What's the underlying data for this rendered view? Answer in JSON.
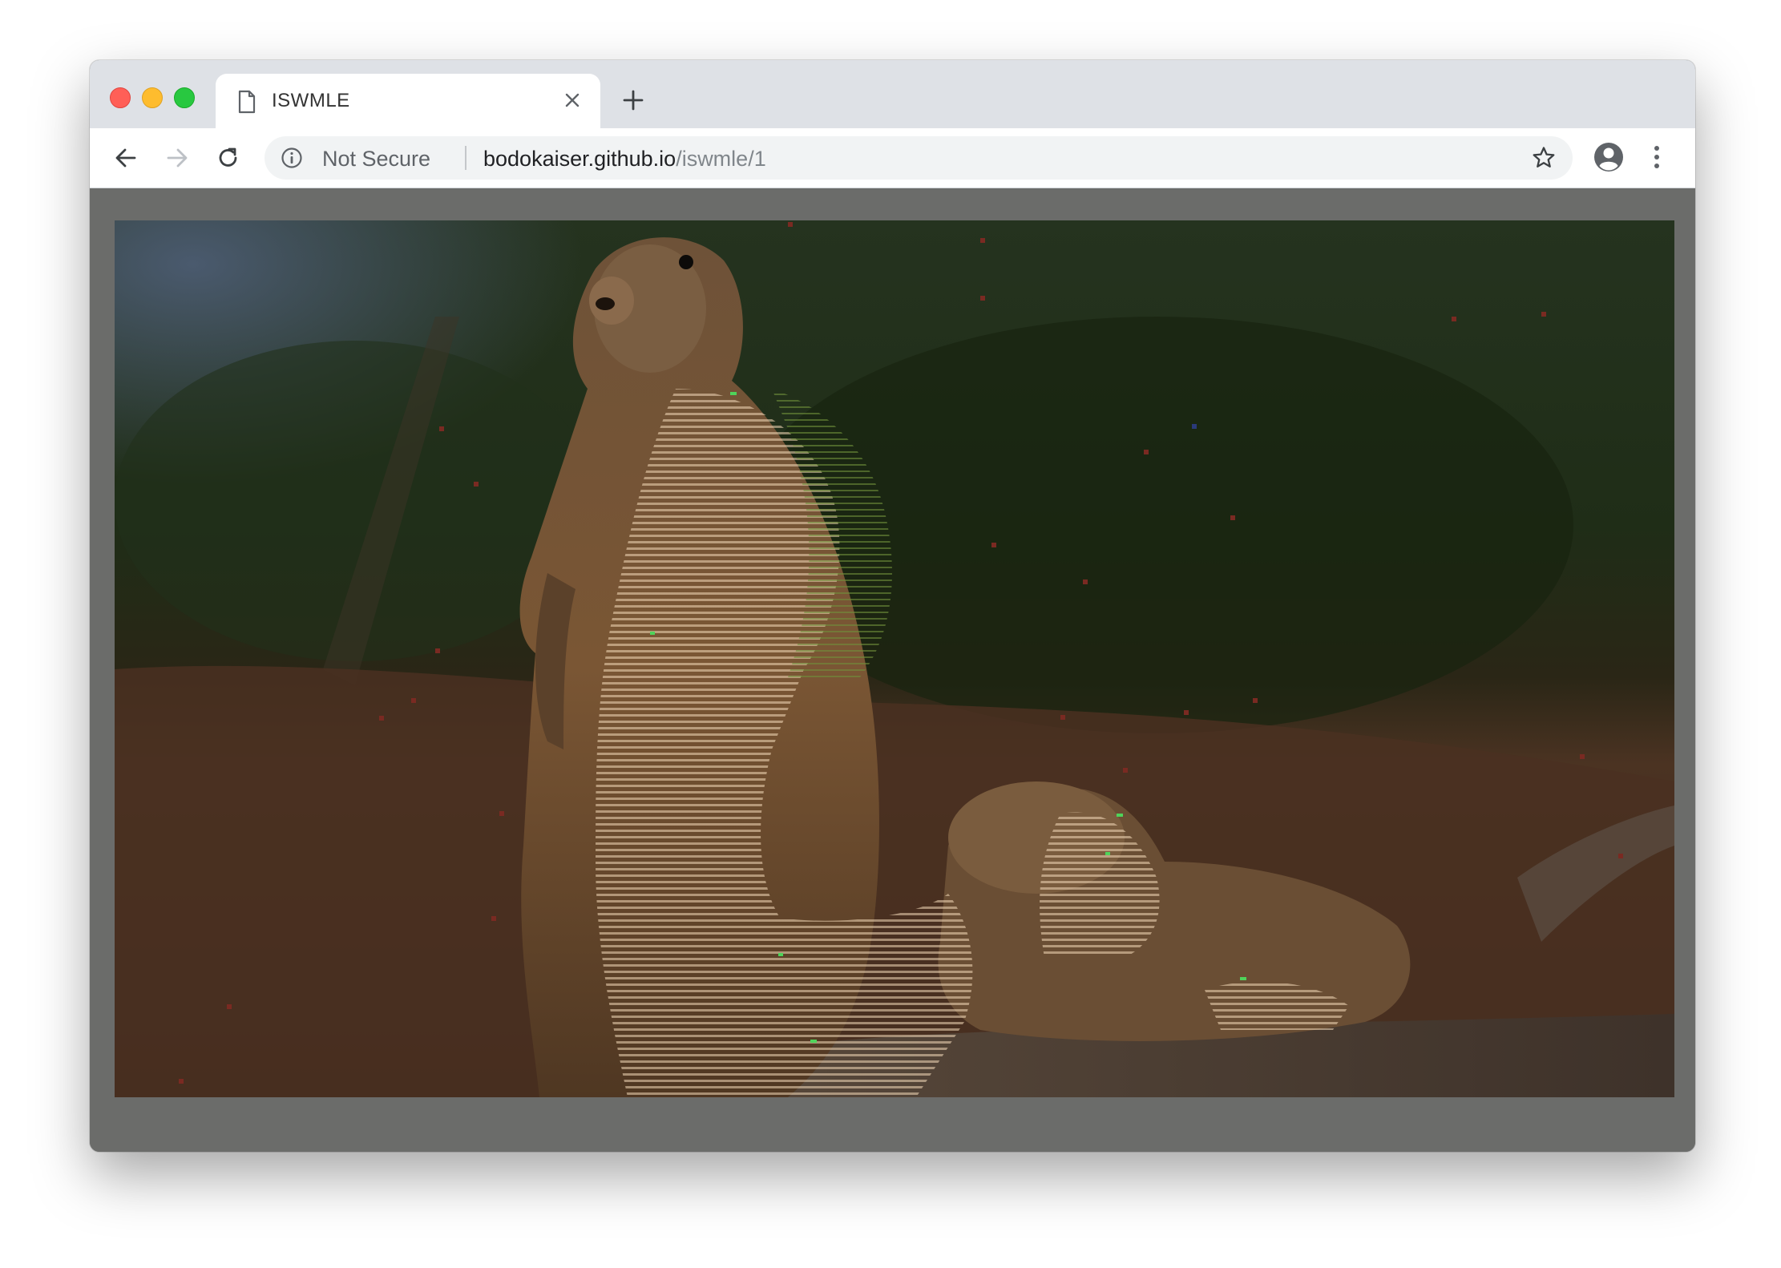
{
  "browser": {
    "tab": {
      "title": "ISWMLE",
      "icon": "document-icon"
    },
    "toolbar": {
      "security_label": "Not Secure",
      "url_host": "bodokaiser.github.io",
      "url_path": "/iswmle/1"
    }
  },
  "page": {
    "image": {
      "subject": "prairie-dogs",
      "effect": "horizontal scanline reveal"
    }
  },
  "colors": {
    "page_background": "#6b6c6a",
    "tabbar": "#dee1e6",
    "omnibox": "#f1f3f4"
  }
}
